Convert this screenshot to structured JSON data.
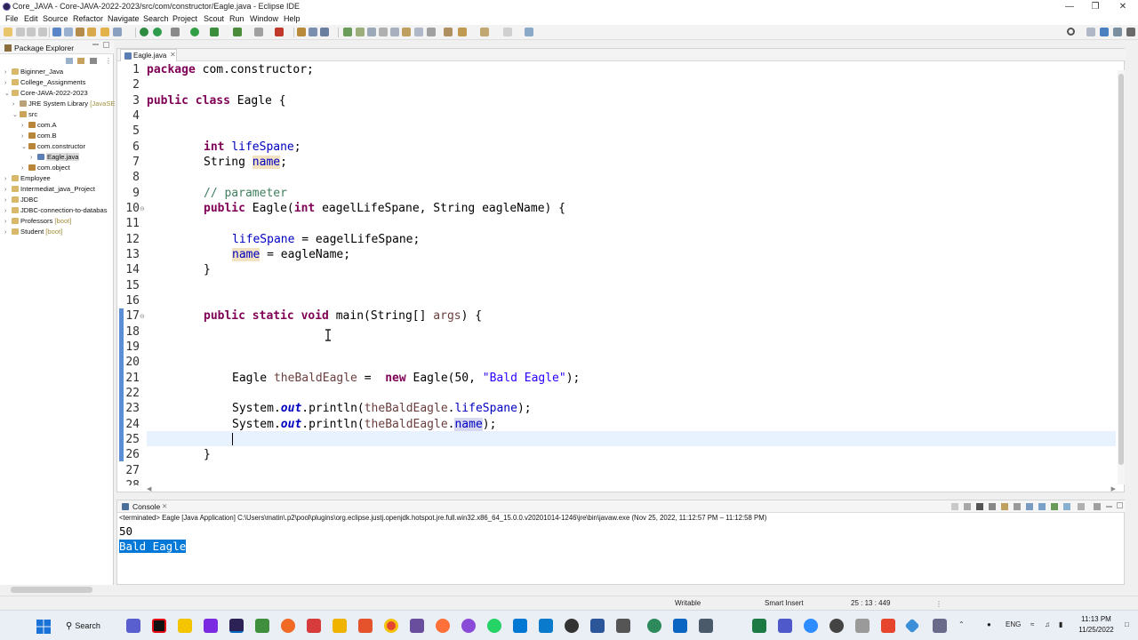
{
  "window": {
    "title": "Core_JAVA - Core-JAVA-2022-2023/src/com/constructor/Eagle.java - Eclipse IDE",
    "controls": [
      "—",
      "❐",
      "✕"
    ]
  },
  "menu": [
    "File",
    "Edit",
    "Source",
    "Refactor",
    "Navigate",
    "Search",
    "Project",
    "Scout",
    "Run",
    "Window",
    "Help"
  ],
  "package_explorer": {
    "title": "Package Explorer",
    "items": [
      {
        "label": "Biginner_Java",
        "suffix": ""
      },
      {
        "label": "College_Assignments",
        "suffix": ""
      },
      {
        "label": "Core-JAVA-2022-2023",
        "suffix": ""
      },
      {
        "label": "JRE System Library ",
        "suffix": "[JavaSE"
      },
      {
        "label": "src",
        "suffix": ""
      },
      {
        "label": "com.A",
        "suffix": ""
      },
      {
        "label": "com.B",
        "suffix": ""
      },
      {
        "label": "com.constructor",
        "suffix": ""
      },
      {
        "label": "Eagle.java",
        "suffix": ""
      },
      {
        "label": "com.object",
        "suffix": ""
      },
      {
        "label": "Employee",
        "suffix": ""
      },
      {
        "label": "Intermediat_java_Project",
        "suffix": ""
      },
      {
        "label": "JDBC",
        "suffix": ""
      },
      {
        "label": "JDBC-connection-to-databas",
        "suffix": ""
      },
      {
        "label": "Professors ",
        "suffix": "[boot]"
      },
      {
        "label": "Student ",
        "suffix": "[boot]"
      }
    ]
  },
  "editor": {
    "tab_label": "Eagle.java",
    "tab_close": "✕",
    "line_numbers": [
      "1",
      "2",
      "3",
      "4",
      "5",
      "6",
      "7",
      "8",
      "9",
      "10",
      "11",
      "12",
      "13",
      "14",
      "15",
      "16",
      "17",
      "18",
      "19",
      "20",
      "21",
      "22",
      "23",
      "24",
      "25",
      "26",
      "27",
      "28"
    ],
    "code": {
      "l1_kw": "package",
      "l1_rest": " com.constructor;",
      "l3_kw": "public class",
      "l3_rest": " Eagle {",
      "l6_kw": "int",
      "l6_fld": "lifeSpane",
      "l6_end": ";",
      "l7_type": "String ",
      "l7_fld": "name",
      "l7_end": ";",
      "l9_comment": "// parameter",
      "l10_kw": "public",
      "l10_a": " Eagle(",
      "l10_kw2": "int",
      "l10_b": " eagelLifeSpane, String eagleName) {",
      "l12_fld": "lifeSpane",
      "l12_rest": " = eagelLifeSpane;",
      "l13_fld": "name",
      "l13_rest": " = eagleName;",
      "l14": "}",
      "l17_kw": "public static void",
      "l17_a": " main(String[] ",
      "l17_var": "args",
      "l17_b": ") {",
      "l21_a": "Eagle ",
      "l21_var": "theBaldEagle",
      "l21_b": " =  ",
      "l21_kw": "new",
      "l21_c": " Eagle(50, ",
      "l21_str": "\"Bald Eagle\"",
      "l21_d": ");",
      "l23_a": "System.",
      "l23_out": "out",
      "l23_b": ".println(",
      "l23_var": "theBaldEagle",
      "l23_c": ".",
      "l23_fld": "lifeSpane",
      "l23_d": ");",
      "l24_a": "System.",
      "l24_out": "out",
      "l24_b": ".println(",
      "l24_var": "theBaldEagle",
      "l24_c": ".",
      "l24_fld": "name",
      "l24_d": ");",
      "l26": "}"
    }
  },
  "console": {
    "title": "Console",
    "close": "✕",
    "terminated": "<terminated> Eagle [Java Application] C:\\Users\\matin\\.p2\\pool\\plugins\\org.eclipse.justj.openjdk.hotspot.jre.full.win32.x86_64_15.0.0.v20201014-1246\\jre\\bin\\javaw.exe  (Nov 25, 2022, 11:12:57 PM – 11:12:58 PM)",
    "output_line1": "50",
    "output_line2": "Bald Eagle"
  },
  "status": {
    "writable": "Writable",
    "insert_mode": "Smart Insert",
    "position": "25 : 13 : 449"
  },
  "taskbar": {
    "search_label": "Search",
    "lang": "ENG",
    "time": "11:13 PM",
    "date": "11/25/2022"
  }
}
